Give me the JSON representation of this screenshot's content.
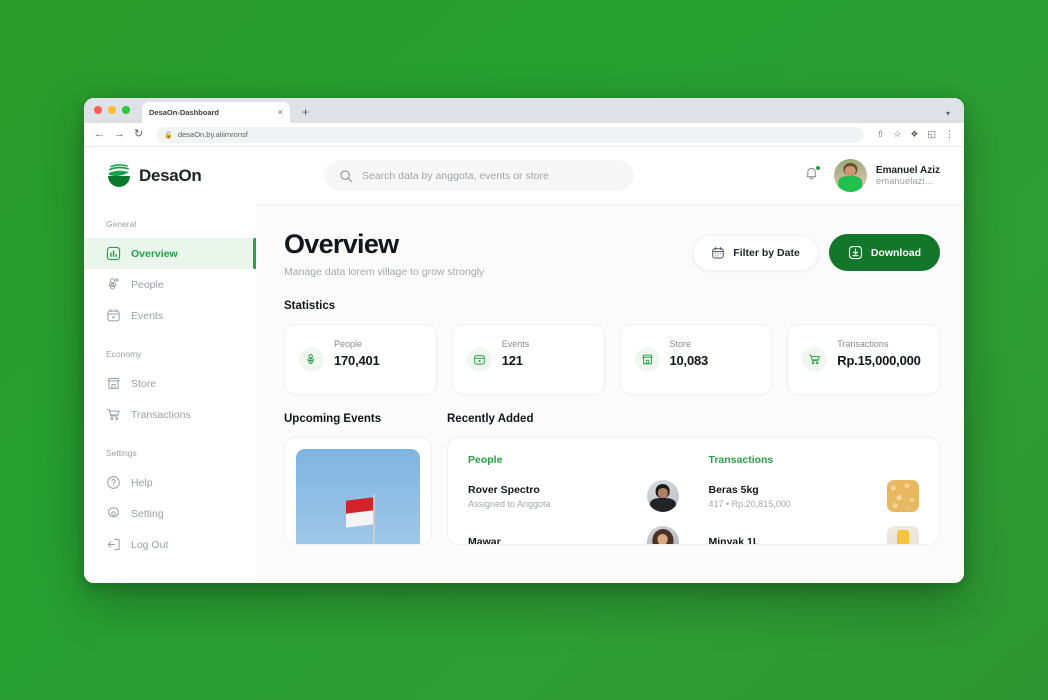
{
  "browser": {
    "tab_title": "DesaOn-Dashboard",
    "tab_close": "×",
    "new_tab": "+",
    "tab_list_chevron": "▾",
    "back": "←",
    "forward": "→",
    "reload": "↻",
    "lock": "🔒",
    "url": "desaOn.by.aliimronsf",
    "share": "⇧",
    "bookmark": "☆",
    "extensions": "❖",
    "sidepanel": "◱",
    "menu": "⋮"
  },
  "sidebar": {
    "brand": "DesaOn",
    "groups": [
      {
        "label": "General",
        "items": [
          {
            "label": "Overview",
            "icon": "chart-icon",
            "active": true
          },
          {
            "label": "People",
            "icon": "people-icon",
            "active": false
          },
          {
            "label": "Events",
            "icon": "calendar-icon",
            "active": false
          }
        ]
      },
      {
        "label": "Economy",
        "items": [
          {
            "label": "Store",
            "icon": "store-icon",
            "active": false
          },
          {
            "label": "Transactions",
            "icon": "cart-icon",
            "active": false
          }
        ]
      },
      {
        "label": "Settings",
        "items": [
          {
            "label": "Help",
            "icon": "help-icon",
            "active": false
          },
          {
            "label": "Setting",
            "icon": "gear-icon",
            "active": false
          },
          {
            "label": "Log Out",
            "icon": "logout-icon",
            "active": false
          }
        ]
      }
    ]
  },
  "header": {
    "search_placeholder": "Search data by anggota, events or store",
    "notification_icon": "bell-icon",
    "user_name": "Emanuel Aziz",
    "user_handle": "emanuelazi…"
  },
  "page": {
    "title": "Overview",
    "subtitle": "Manage data  lorem village to grow strongly",
    "filter_button": "Filter by Date",
    "download_button": "Download",
    "statistics_heading": "Statistics"
  },
  "statistics": [
    {
      "label": "People",
      "value": "170,401",
      "icon": "people-icon"
    },
    {
      "label": "Events",
      "value": "121",
      "icon": "calendar-icon"
    },
    {
      "label": "Store",
      "value": "10,083",
      "icon": "store-icon"
    },
    {
      "label": "Transactions",
      "value": "Rp.15,000,000",
      "icon": "cart-icon"
    }
  ],
  "upcoming_events": {
    "heading": "Upcoming Events"
  },
  "recently_added": {
    "heading": "Recently Added",
    "people": {
      "heading": "People",
      "rows": [
        {
          "title": "Rover Spectro",
          "sub": "Assigned to Anggota"
        },
        {
          "title": "Mawar",
          "sub": ""
        }
      ]
    },
    "transactions": {
      "heading": "Transactions",
      "rows": [
        {
          "title": "Beras 5kg",
          "sub": "417 • Rp.20,815,000"
        },
        {
          "title": "Minyak 1L",
          "sub": ""
        }
      ]
    }
  },
  "colors": {
    "brand_green": "#25a244",
    "deep_green": "#13772b",
    "active_bg": "#eaf6ec"
  }
}
